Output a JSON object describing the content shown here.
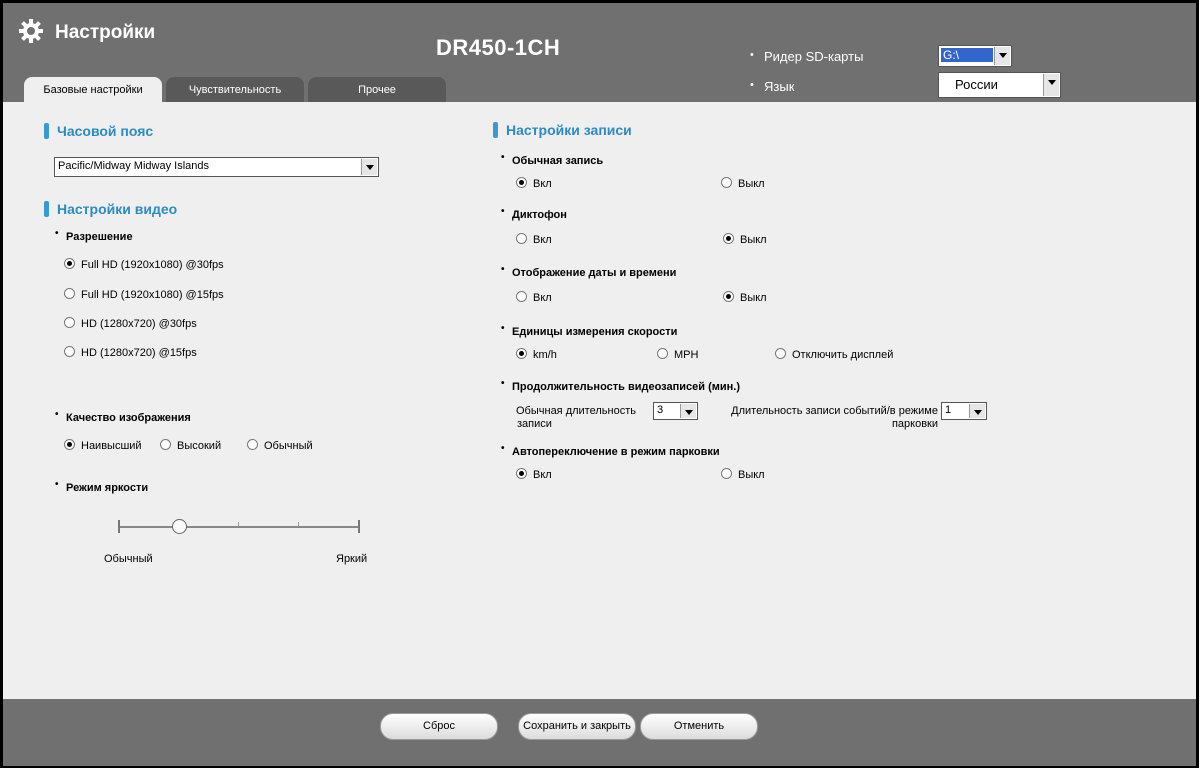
{
  "header": {
    "title": "Настройки",
    "model": "DR450-1CH",
    "sd_reader_label": "Ридер SD-карты",
    "sd_reader_value": "G:\\",
    "language_label": "Язык",
    "language_value": "России",
    "bullet": "•"
  },
  "tabs": [
    {
      "label": "Базовые настройки",
      "active": true
    },
    {
      "label": "Чувствительность",
      "active": false
    },
    {
      "label": "Прочее",
      "active": false
    }
  ],
  "timezone": {
    "title": "Часовой пояс",
    "value": "Pacific/Midway Midway Islands"
  },
  "video": {
    "title": "Настройки видео",
    "resolution_title": "Разрешение",
    "resolutions": [
      {
        "label": "Full HD (1920x1080) @30fps",
        "checked": true
      },
      {
        "label": "Full HD (1920x1080) @15fps",
        "checked": false
      },
      {
        "label": "HD (1280x720) @30fps",
        "checked": false
      },
      {
        "label": "HD (1280x720) @15fps",
        "checked": false
      }
    ],
    "quality_title": "Качество изображения",
    "quality": [
      {
        "label": "Наивысший",
        "checked": true
      },
      {
        "label": "Высокий",
        "checked": false
      },
      {
        "label": "Обычный",
        "checked": false
      }
    ],
    "brightness_title": "Режим яркости",
    "brightness_min": "Обычный",
    "brightness_max": "Яркий",
    "brightness_level": 0.25
  },
  "record": {
    "title": "Настройки записи",
    "normal_title": "Обычная запись",
    "normal": [
      {
        "label": "Вкл",
        "checked": true
      },
      {
        "label": "Выкл",
        "checked": false
      }
    ],
    "dictaphone_title": "Диктофон",
    "dictaphone": [
      {
        "label": "Вкл",
        "checked": false
      },
      {
        "label": "Выкл",
        "checked": true
      }
    ],
    "datetime_title": "Отображение даты и времени",
    "datetime": [
      {
        "label": "Вкл",
        "checked": false
      },
      {
        "label": "Выкл",
        "checked": true
      }
    ],
    "speed_title": "Единицы измерения скорости",
    "speed": [
      {
        "label": "km/h",
        "checked": true
      },
      {
        "label": "MPH",
        "checked": false
      },
      {
        "label": "Отключить дисплей",
        "checked": false
      }
    ],
    "duration_title": "Продолжительность видеозаписей (мин.)",
    "normal_duration_label_1": "Обычная длительность",
    "normal_duration_label_2": "записи",
    "normal_duration_value": "3",
    "event_duration_label_1": "Длительность записи событий/в режиме",
    "event_duration_label_2": "парковки",
    "event_duration_value": "1",
    "parking_title": "Автопереключение в режим парковки",
    "parking": [
      {
        "label": "Вкл",
        "checked": true
      },
      {
        "label": "Выкл",
        "checked": false
      }
    ]
  },
  "buttons": {
    "reset": "Сброс",
    "save": "Сохранить и закрыть",
    "cancel": "Отменить"
  }
}
